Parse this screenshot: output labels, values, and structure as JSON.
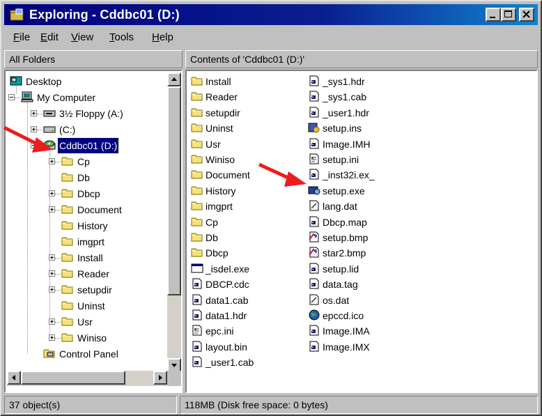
{
  "window": {
    "title": "Exploring - Cddbc01 (D:)"
  },
  "menu": {
    "items": [
      {
        "pre": "",
        "key": "F",
        "post": "ile"
      },
      {
        "pre": "",
        "key": "E",
        "post": "dit"
      },
      {
        "pre": "",
        "key": "V",
        "post": "iew"
      },
      {
        "pre": "",
        "key": "T",
        "post": "ools"
      },
      {
        "pre": "",
        "key": "H",
        "post": "elp"
      }
    ]
  },
  "folders_header": "All Folders",
  "contents_header": "Contents of 'Cddbc01 (D:)'",
  "tree": [
    {
      "label": "Desktop",
      "icon": "desktop-icon"
    },
    {
      "label": "My Computer",
      "icon": "computer-icon"
    },
    {
      "label": "3½ Floppy (A:)",
      "icon": "floppy-icon"
    },
    {
      "label": "(C:)",
      "icon": "hard-drive-icon"
    },
    {
      "label": "Cddbc01 (D:)",
      "icon": "cd-drive-icon"
    },
    {
      "label": "Cp",
      "icon": "folder-icon"
    },
    {
      "label": "Db",
      "icon": "folder-icon"
    },
    {
      "label": "Dbcp",
      "icon": "folder-icon"
    },
    {
      "label": "Document",
      "icon": "folder-icon"
    },
    {
      "label": "History",
      "icon": "folder-icon"
    },
    {
      "label": "imgprt",
      "icon": "folder-icon"
    },
    {
      "label": "Install",
      "icon": "folder-icon"
    },
    {
      "label": "Reader",
      "icon": "folder-icon"
    },
    {
      "label": "setupdir",
      "icon": "folder-icon"
    },
    {
      "label": "Uninst",
      "icon": "folder-icon"
    },
    {
      "label": "Usr",
      "icon": "folder-icon"
    },
    {
      "label": "Winiso",
      "icon": "folder-icon"
    },
    {
      "label": "Control Panel",
      "icon": "control-panel-icon"
    }
  ],
  "files_col1": [
    {
      "name": "Install",
      "icon": "folder-icon"
    },
    {
      "name": "Reader",
      "icon": "folder-icon"
    },
    {
      "name": "setupdir",
      "icon": "folder-icon"
    },
    {
      "name": "Uninst",
      "icon": "folder-icon"
    },
    {
      "name": "Usr",
      "icon": "folder-icon"
    },
    {
      "name": "Winiso",
      "icon": "folder-icon"
    },
    {
      "name": "Document",
      "icon": "folder-icon"
    },
    {
      "name": "History",
      "icon": "folder-icon"
    },
    {
      "name": "imgprt",
      "icon": "folder-icon"
    },
    {
      "name": "Cp",
      "icon": "folder-icon"
    },
    {
      "name": "Db",
      "icon": "folder-icon"
    },
    {
      "name": "Dbcp",
      "icon": "folder-icon"
    },
    {
      "name": "_isdel.exe",
      "icon": "exe-icon"
    },
    {
      "name": "DBCP.cdc",
      "icon": "file-icon"
    },
    {
      "name": "data1.cab",
      "icon": "file-icon"
    },
    {
      "name": "data1.hdr",
      "icon": "file-icon"
    },
    {
      "name": "epc.ini",
      "icon": "ini-icon"
    },
    {
      "name": "layout.bin",
      "icon": "file-icon"
    },
    {
      "name": "_user1.cab",
      "icon": "file-icon"
    }
  ],
  "files_col2": [
    {
      "name": "_sys1.hdr",
      "icon": "file-icon"
    },
    {
      "name": "_sys1.cab",
      "icon": "file-icon"
    },
    {
      "name": "_user1.hdr",
      "icon": "file-icon"
    },
    {
      "name": "setup.ins",
      "icon": "script-icon"
    },
    {
      "name": "Image.IMH",
      "icon": "file-icon"
    },
    {
      "name": "setup.ini",
      "icon": "ini-icon"
    },
    {
      "name": "_inst32i.ex_",
      "icon": "file-icon"
    },
    {
      "name": "setup.exe",
      "icon": "setup-exe-icon"
    },
    {
      "name": "lang.dat",
      "icon": "text-file-icon"
    },
    {
      "name": "Dbcp.map",
      "icon": "file-icon"
    },
    {
      "name": "setup.bmp",
      "icon": "bitmap-icon"
    },
    {
      "name": "star2.bmp",
      "icon": "bitmap-icon"
    },
    {
      "name": "setup.lid",
      "icon": "file-icon"
    },
    {
      "name": "data.tag",
      "icon": "file-icon"
    },
    {
      "name": "os.dat",
      "icon": "text-file-icon"
    },
    {
      "name": "epccd.ico",
      "icon": "globe-icon"
    },
    {
      "name": "Image.IMA",
      "icon": "file-icon"
    },
    {
      "name": "Image.IMX",
      "icon": "file-icon"
    }
  ],
  "status": {
    "objects": "37 object(s)",
    "size": "118MB (Disk free space: 0 bytes)"
  }
}
